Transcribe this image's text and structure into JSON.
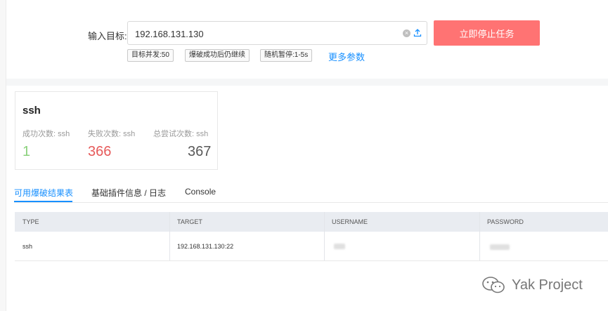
{
  "target": {
    "label": "输入目标:",
    "value": "192.168.131.130",
    "clear_icon_glyph": "×",
    "stop_button_label": "立即停止任务"
  },
  "params": {
    "tags": [
      "目标并发:50",
      "爆破成功后仍继续",
      "随机暂停:1-5s"
    ],
    "more_link": "更多参数"
  },
  "summary": {
    "title": "ssh",
    "stats": [
      {
        "label": "成功次数: ssh",
        "value": "1",
        "color": "#8bd17c"
      },
      {
        "label": "失败次数: ssh",
        "value": "366",
        "color": "#e65a5a"
      },
      {
        "label": "总尝试次数: ssh",
        "value": "367",
        "color": "#595959"
      }
    ]
  },
  "tabs": [
    "可用爆破结果表",
    "基础插件信息 / 日志",
    "Console"
  ],
  "table": {
    "columns": [
      "TYPE",
      "TARGET",
      "USERNAME",
      "PASSWORD"
    ],
    "rows": [
      {
        "type": "ssh",
        "target": "192.168.131.130:22",
        "username": "",
        "password": ""
      }
    ]
  },
  "watermark": {
    "text": "Yak Project",
    "icon": "wechat-icon"
  },
  "colors": {
    "accent": "#1890ff",
    "stop_button": "#ff7373",
    "success": "#8bd17c",
    "failure": "#e65a5a"
  }
}
